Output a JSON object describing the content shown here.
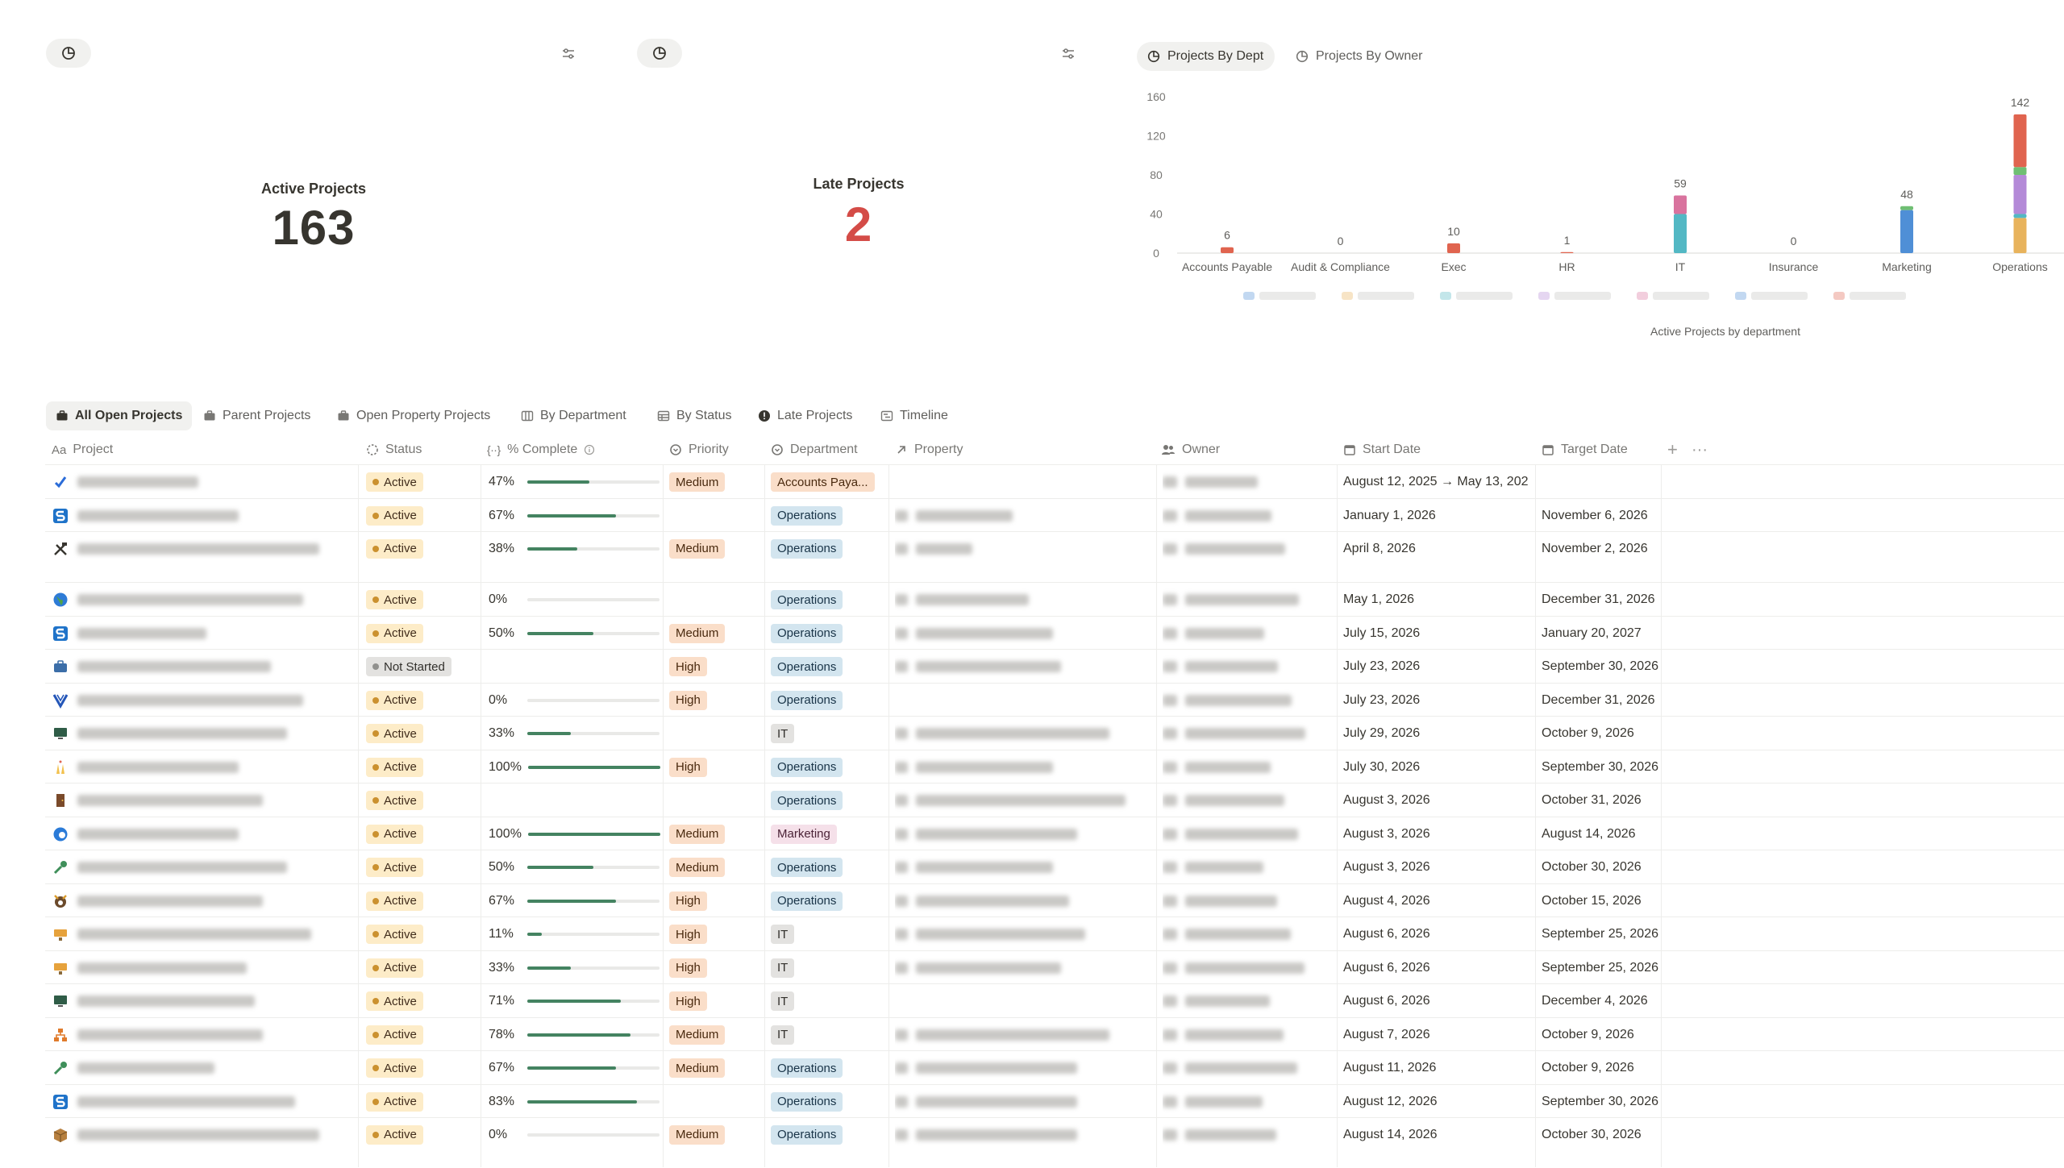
{
  "kpis": [
    {
      "label": "Active Projects",
      "value": "163",
      "color": "#37352f"
    },
    {
      "label": "Late Projects",
      "value": "2",
      "color": "#d44c47"
    }
  ],
  "chart_tabs": [
    "Projects By Dept",
    "Projects By Owner"
  ],
  "chart_data": {
    "type": "bar",
    "stacked": true,
    "title": "",
    "xlabel": "",
    "ylabel": "",
    "caption": "Active Projects by department",
    "ylim": [
      0,
      160
    ],
    "yticks": [
      "0",
      "40",
      "80",
      "120",
      "160"
    ],
    "categories": [
      "Accounts Payable",
      "Audit & Compliance",
      "Exec",
      "HR",
      "IT",
      "Insurance",
      "Marketing",
      "Operations"
    ],
    "totals": [
      6,
      0,
      10,
      1,
      59,
      0,
      48,
      142
    ],
    "series": [
      {
        "color": "#4f8fd6",
        "values": [
          0,
          0,
          0,
          0,
          0,
          0,
          44,
          0
        ]
      },
      {
        "color": "#e8b35c",
        "values": [
          0,
          0,
          0,
          0,
          0,
          0,
          0,
          36
        ]
      },
      {
        "color": "#53b8c4",
        "values": [
          0,
          0,
          0,
          0,
          40,
          0,
          0,
          4
        ]
      },
      {
        "color": "#b48ad8",
        "values": [
          0,
          0,
          0,
          0,
          0,
          0,
          0,
          40
        ]
      },
      {
        "color": "#d9739e",
        "values": [
          0,
          0,
          0,
          0,
          19,
          0,
          0,
          0
        ]
      },
      {
        "color": "#6fbf73",
        "values": [
          0,
          0,
          0,
          0,
          0,
          0,
          4,
          8
        ]
      },
      {
        "color": "#e0644f",
        "values": [
          6,
          0,
          10,
          1,
          0,
          0,
          0,
          54
        ]
      }
    ]
  },
  "view_tabs": [
    "All Open Projects",
    "Parent Projects",
    "Open Property Projects",
    "By Department",
    "By Status",
    "Late Projects",
    "Timeline"
  ],
  "columns": [
    "Project",
    "Status",
    "% Complete",
    "Priority",
    "Department",
    "Property",
    "Owner",
    "Start Date",
    "Target Date"
  ],
  "rows": [
    {
      "icon": "check-icon",
      "status": "Active",
      "pct": 47,
      "pct_label": "47%",
      "priority": "Medium",
      "dept": "Accounts Paya...",
      "start": "August 12, 2025 → May 13, 202",
      "target": ""
    },
    {
      "icon": "s-logo-icon",
      "status": "Active",
      "pct": 67,
      "pct_label": "67%",
      "priority": "",
      "dept": "Operations",
      "start": "January 1, 2026",
      "target": "November 6, 2026"
    },
    {
      "icon": "tools-icon",
      "status": "Active",
      "pct": 38,
      "pct_label": "38%",
      "priority": "Medium",
      "dept": "Operations",
      "start": "April 8, 2026",
      "target": "November 2, 2026"
    },
    {
      "icon": "globe-icon",
      "status": "Active",
      "pct": 0,
      "pct_label": "0%",
      "priority": "",
      "dept": "Operations",
      "start": "May 1, 2026",
      "target": "December 31, 2026"
    },
    {
      "icon": "s-logo-icon",
      "status": "Active",
      "pct": 50,
      "pct_label": "50%",
      "priority": "Medium",
      "dept": "Operations",
      "start": "July 15, 2026",
      "target": "January 20, 2027"
    },
    {
      "icon": "briefcase-icon",
      "status": "Not Started",
      "pct": null,
      "pct_label": "",
      "priority": "High",
      "dept": "Operations",
      "start": "July 23, 2026",
      "target": "September 30, 2026"
    },
    {
      "icon": "v-logo-icon",
      "status": "Active",
      "pct": 0,
      "pct_label": "0%",
      "priority": "High",
      "dept": "Operations",
      "start": "July 23, 2026",
      "target": "December 31, 2026"
    },
    {
      "icon": "monitor-icon",
      "status": "Active",
      "pct": 33,
      "pct_label": "33%",
      "priority": "",
      "dept": "IT",
      "start": "July 29, 2026",
      "target": "October 9, 2026"
    },
    {
      "icon": "celebration-icon",
      "status": "Active",
      "pct": 100,
      "pct_label": "100%",
      "priority": "High",
      "dept": "Operations",
      "start": "July 30, 2026",
      "target": "September 30, 2026"
    },
    {
      "icon": "door-icon",
      "status": "Active",
      "pct": null,
      "pct_label": "",
      "priority": "",
      "dept": "Operations",
      "start": "August 3, 2026",
      "target": "October 31, 2026"
    },
    {
      "icon": "edge-logo-icon",
      "status": "Active",
      "pct": 100,
      "pct_label": "100%",
      "priority": "Medium",
      "dept": "Marketing",
      "start": "August 3, 2026",
      "target": "August 14, 2026"
    },
    {
      "icon": "key-icon",
      "status": "Active",
      "pct": 50,
      "pct_label": "50%",
      "priority": "Medium",
      "dept": "Operations",
      "start": "August 3, 2026",
      "target": "October 30, 2026"
    },
    {
      "icon": "mascot-icon",
      "status": "Active",
      "pct": 67,
      "pct_label": "67%",
      "priority": "High",
      "dept": "Operations",
      "start": "August 4, 2026",
      "target": "October 15, 2026"
    },
    {
      "icon": "desk-icon",
      "status": "Active",
      "pct": 11,
      "pct_label": "11%",
      "priority": "High",
      "dept": "IT",
      "start": "August 6, 2026",
      "target": "September 25, 2026"
    },
    {
      "icon": "desk-icon",
      "status": "Active",
      "pct": 33,
      "pct_label": "33%",
      "priority": "High",
      "dept": "IT",
      "start": "August 6, 2026",
      "target": "September 25, 2026"
    },
    {
      "icon": "monitor-icon",
      "status": "Active",
      "pct": 71,
      "pct_label": "71%",
      "priority": "High",
      "dept": "IT",
      "start": "August 6, 2026",
      "target": "December 4, 2026"
    },
    {
      "icon": "network-icon",
      "status": "Active",
      "pct": 78,
      "pct_label": "78%",
      "priority": "Medium",
      "dept": "IT",
      "start": "August 7, 2026",
      "target": "October 9, 2026"
    },
    {
      "icon": "key-icon",
      "status": "Active",
      "pct": 67,
      "pct_label": "67%",
      "priority": "Medium",
      "dept": "Operations",
      "start": "August 11, 2026",
      "target": "October 9, 2026"
    },
    {
      "icon": "s-logo-icon",
      "status": "Active",
      "pct": 83,
      "pct_label": "83%",
      "priority": "",
      "dept": "Operations",
      "start": "August 12, 2026",
      "target": "September 30, 2026"
    },
    {
      "icon": "box-icon",
      "status": "Active",
      "pct": 0,
      "pct_label": "0%",
      "priority": "Medium",
      "dept": "Operations",
      "start": "August 14, 2026",
      "target": "October 30, 2026"
    }
  ]
}
